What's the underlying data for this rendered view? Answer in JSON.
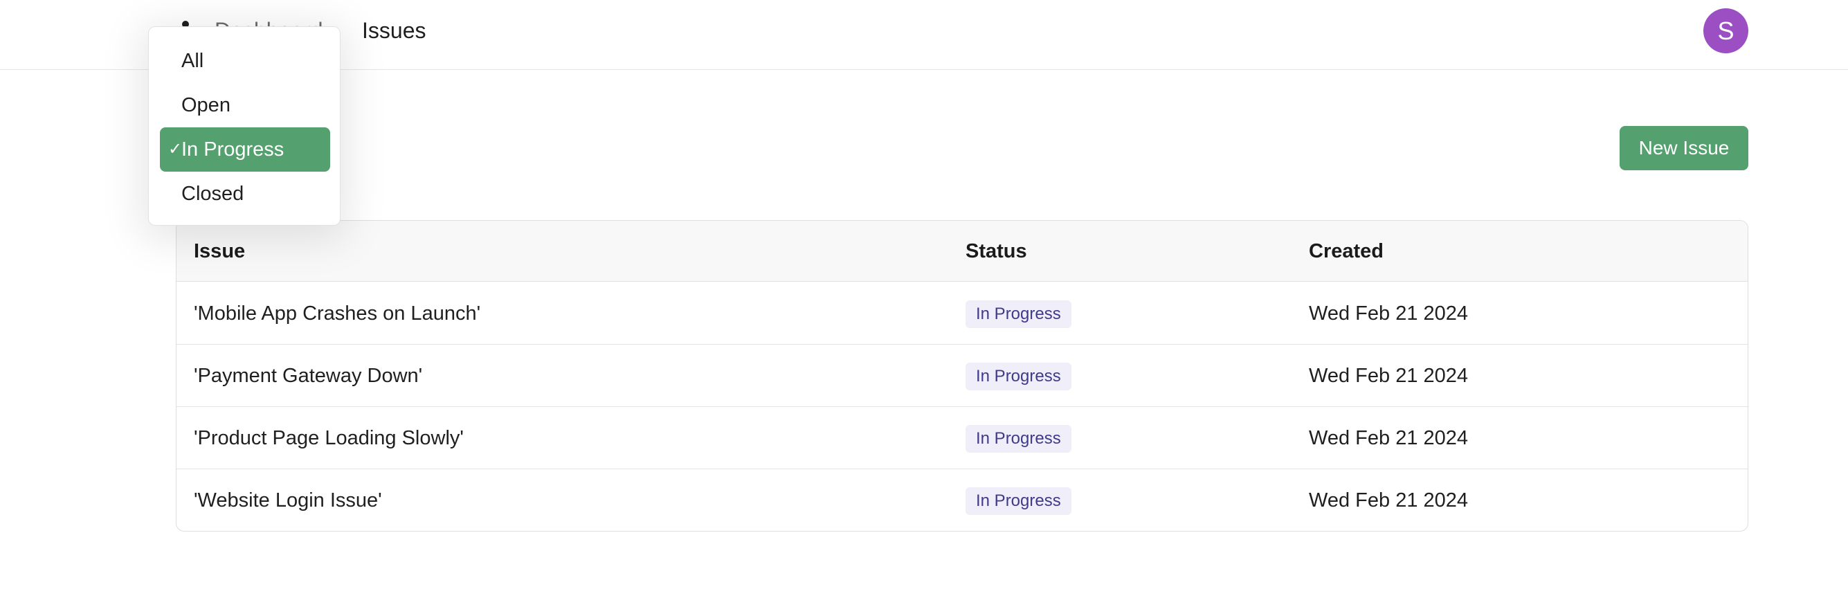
{
  "nav": {
    "logo_icon": "bug-icon",
    "dashboard_label": "Dashboard",
    "issues_label": "Issues",
    "avatar_initial": "S"
  },
  "actions": {
    "new_issue_label": "New Issue"
  },
  "filter_dropdown": {
    "options": [
      {
        "label": "All",
        "selected": false
      },
      {
        "label": "Open",
        "selected": false
      },
      {
        "label": "In Progress",
        "selected": true
      },
      {
        "label": "Closed",
        "selected": false
      }
    ],
    "check_glyph": "✓"
  },
  "table": {
    "columns": [
      "Issue",
      "Status",
      "Created"
    ],
    "rows": [
      {
        "issue": "'Mobile App Crashes on Launch'",
        "status": "In Progress",
        "created": "Wed Feb 21 2024"
      },
      {
        "issue": "'Payment Gateway Down'",
        "status": "In Progress",
        "created": "Wed Feb 21 2024"
      },
      {
        "issue": "'Product Page Loading Slowly'",
        "status": "In Progress",
        "created": "Wed Feb 21 2024"
      },
      {
        "issue": "'Website Login Issue'",
        "status": "In Progress",
        "created": "Wed Feb 21 2024"
      }
    ]
  },
  "colors": {
    "accent_green": "#55a06f",
    "avatar_purple": "#9b4fc2",
    "badge_bg": "#efeef9",
    "badge_text": "#3f3a8c"
  }
}
